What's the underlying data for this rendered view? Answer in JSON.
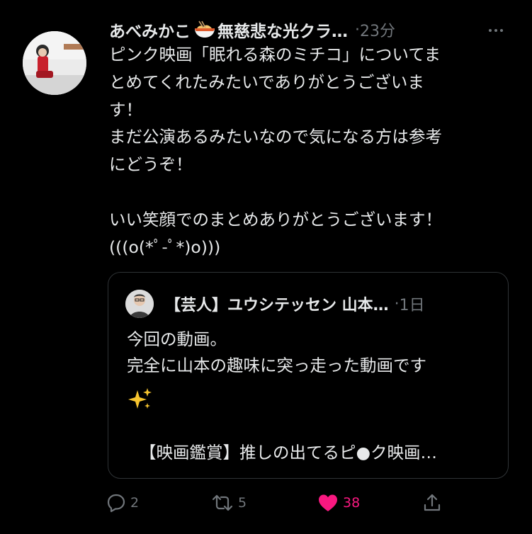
{
  "tweet": {
    "author_name": "あべみかこ",
    "name_emoji": "ramen-bowl-emoji",
    "author_suffix": "無慈悲な光クラ…",
    "separator": "·",
    "time": "23分",
    "more_icon": "more-icon",
    "body": "ピンク映画「眠れる森のミチコ」についてま\nとめてくれたみたいでありがとうございま\nす！\nまだ公演あるみたいなので気になる方は参考\nにどうぞ！\n\nいい笑顔でのまとめありがとうございます！\n(((o(*ﾟ-ﾟ*)o)))"
  },
  "quote": {
    "author_name": "【芸人】ユウシテッセン 山本…",
    "separator": "·",
    "time": "1日",
    "lines": [
      "今回の動画。",
      "完全に山本の趣味に突っ走った動画です"
    ],
    "sparkle_icon": "sparkles-emoji",
    "link_text": "【映画鑑賞】推しの出てるピ●ク映画…"
  },
  "actions": {
    "reply_count": "2",
    "retweet_count": "5",
    "like_count": "38",
    "colors": {
      "muted": "#71767b",
      "like": "#f91880"
    }
  }
}
